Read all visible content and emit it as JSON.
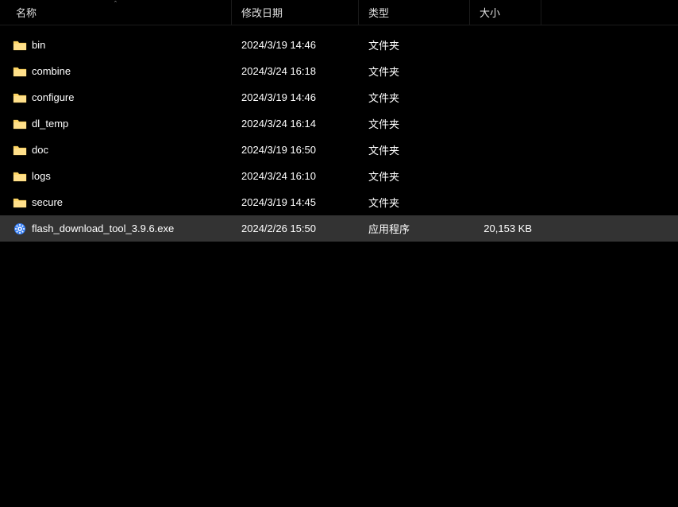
{
  "headers": {
    "name": "名称",
    "date": "修改日期",
    "type": "类型",
    "size": "大小"
  },
  "sort_indicator": "ˆ",
  "files": [
    {
      "icon": "folder",
      "name": "bin",
      "date": "2024/3/19 14:46",
      "type": "文件夹",
      "size": "",
      "selected": false
    },
    {
      "icon": "folder",
      "name": "combine",
      "date": "2024/3/24 16:18",
      "type": "文件夹",
      "size": "",
      "selected": false
    },
    {
      "icon": "folder",
      "name": "configure",
      "date": "2024/3/19 14:46",
      "type": "文件夹",
      "size": "",
      "selected": false
    },
    {
      "icon": "folder",
      "name": "dl_temp",
      "date": "2024/3/24 16:14",
      "type": "文件夹",
      "size": "",
      "selected": false
    },
    {
      "icon": "folder",
      "name": "doc",
      "date": "2024/3/19 16:50",
      "type": "文件夹",
      "size": "",
      "selected": false
    },
    {
      "icon": "folder",
      "name": "logs",
      "date": "2024/3/24 16:10",
      "type": "文件夹",
      "size": "",
      "selected": false
    },
    {
      "icon": "folder",
      "name": "secure",
      "date": "2024/3/19 14:45",
      "type": "文件夹",
      "size": "",
      "selected": false
    },
    {
      "icon": "gear",
      "name": "flash_download_tool_3.9.6.exe",
      "date": "2024/2/26 15:50",
      "type": "应用程序",
      "size": "20,153 KB",
      "selected": true
    }
  ]
}
